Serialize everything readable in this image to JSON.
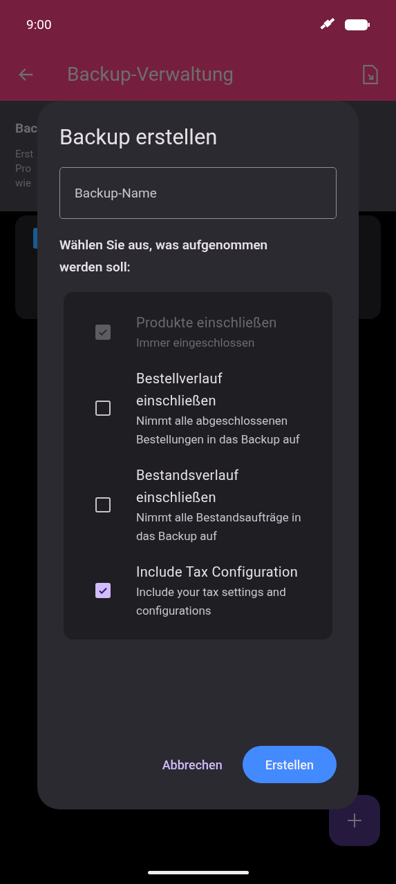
{
  "status_bar": {
    "time": "9:00"
  },
  "app_bar": {
    "title": "Backup-Verwaltung"
  },
  "background": {
    "heading": "Bac",
    "lines": [
      "Erst",
      "Pro",
      "wie"
    ]
  },
  "dialog": {
    "title": "Backup erstellen",
    "name_field": {
      "placeholder": "Backup-Name"
    },
    "prompt": "Wählen Sie aus, was aufgenommen werden soll:",
    "options": [
      {
        "title": "Produkte einschließen",
        "subtitle": "Immer eingeschlossen",
        "checked": true,
        "disabled": true
      },
      {
        "title": "Bestellverlauf einschließen",
        "subtitle": "Nimmt alle abgeschlossenen Bestellungen in das Backup auf",
        "checked": false,
        "disabled": false
      },
      {
        "title": "Bestandsverlauf einschließen",
        "subtitle": "Nimmt alle Bestandsaufträge in das Backup auf",
        "checked": false,
        "disabled": false
      },
      {
        "title": "Include Tax Configuration",
        "subtitle": "Include your tax settings and configurations",
        "checked": true,
        "disabled": false
      }
    ],
    "buttons": [
      {
        "label": "Abbrechen",
        "kind": "text"
      },
      {
        "label": "Erstellen",
        "kind": "filled"
      }
    ]
  }
}
